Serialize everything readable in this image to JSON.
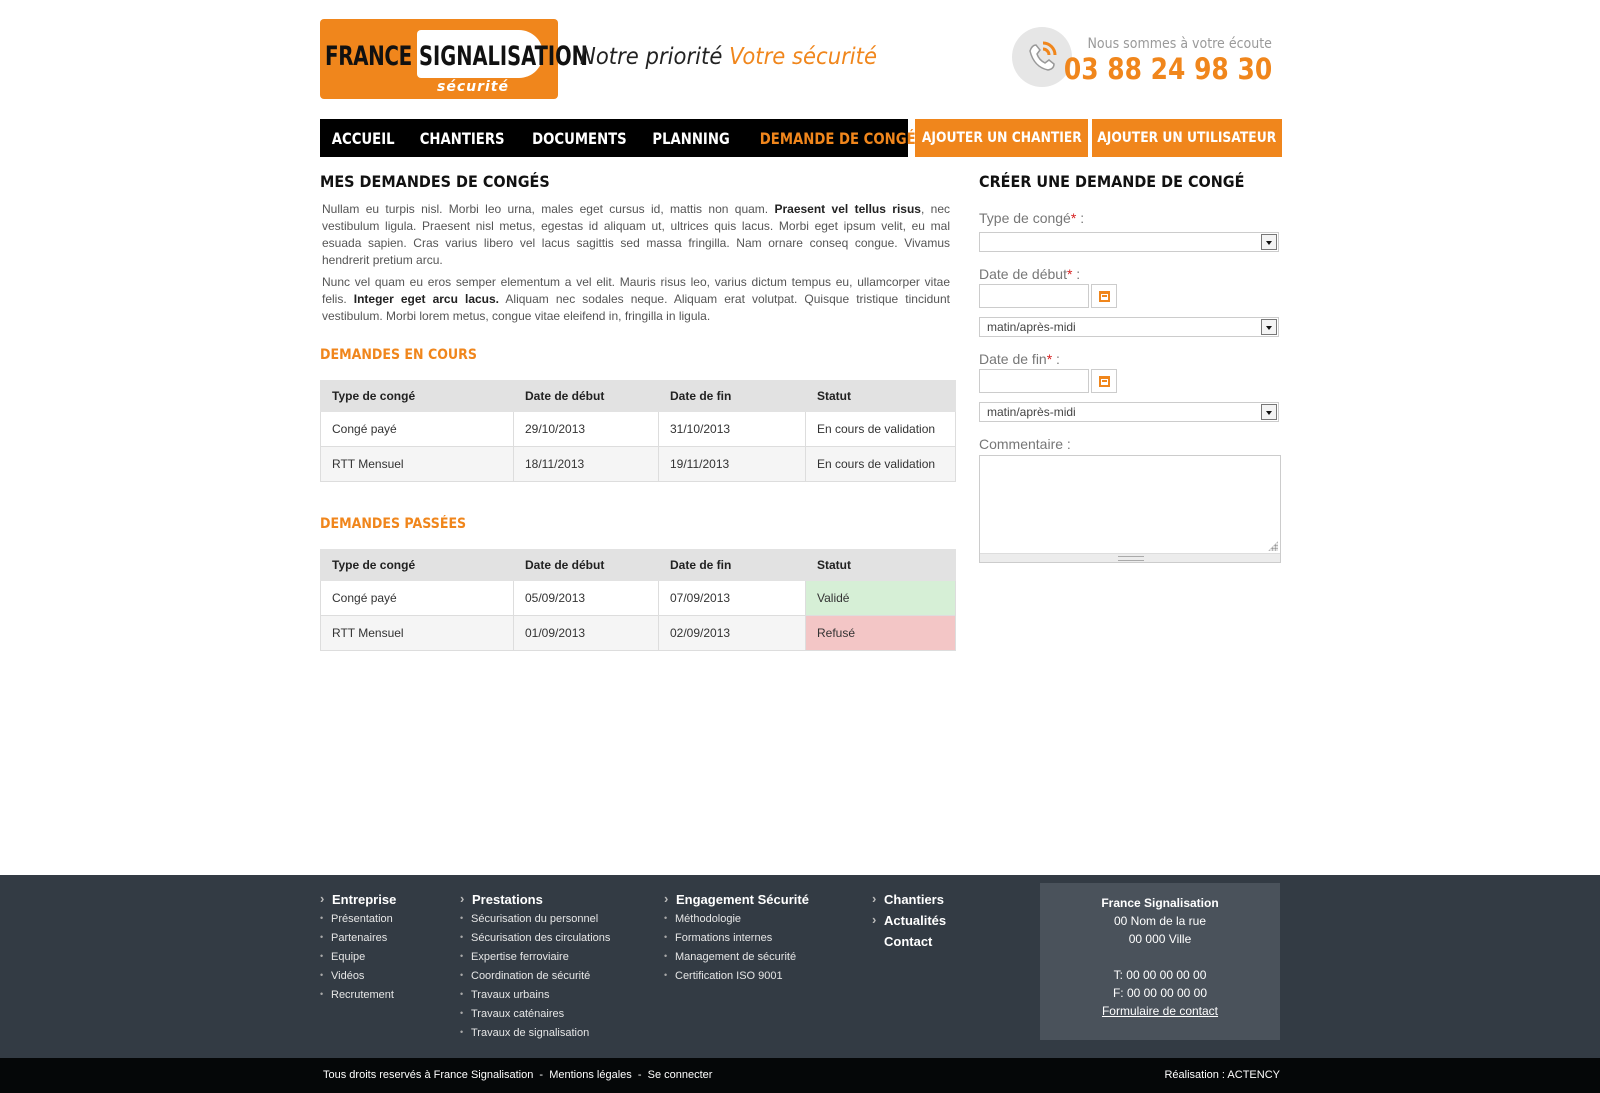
{
  "brand": {
    "logo_word1": "FRANCE",
    "logo_word2": "SIGNALISATION",
    "logo_sub": "sécurité",
    "tagline_part1": "Notre priorité",
    "tagline_part2": "Votre sécurité",
    "listen_text": "Nous sommes à votre écoute",
    "phone": "03 88 24 98 30",
    "accent_color": "#f0861c"
  },
  "nav": {
    "items": [
      {
        "label": "ACCUEIL"
      },
      {
        "label": "CHANTIERS"
      },
      {
        "label": "DOCUMENTS"
      },
      {
        "label": "PLANNING"
      },
      {
        "label": "DEMANDE DE CONGÉ",
        "active": true
      }
    ],
    "add_site": "AJOUTER UN CHANTIER",
    "add_user": "AJOUTER UN UTILISATEUR"
  },
  "main": {
    "title": "MES DEMANDES DE CONGÉS",
    "intro1_a": "Nullam eu turpis nisl. Morbi leo urna, males eget cursus id, mattis non quam. ",
    "intro1_b": "Praesent vel tellus risus",
    "intro1_c": ", nec vestibulum ligula. Praesent nisl metus, egestas id aliquam ut, ultrices quis lacus. Morbi eget ipsum velit, eu mal esuada sapien. Cras varius libero vel lacus sagittis sed massa fringilla. Nam ornare conseq congue. Vivamus hendrerit pretium arcu.",
    "intro2_a": "Nunc vel quam eu eros semper elementum a vel elit. Mauris risus leo, varius dictum tempus eu, ullamcorper vitae felis. ",
    "intro2_b": "Integer eget arcu lacus.",
    "intro2_c": " Aliquam nec sodales neque. Aliquam erat volutpat. Quisque tristique tincidunt vestibulum. Morbi lorem metus, congue vitae eleifend in, fringilla in ligula.",
    "current": {
      "title": "DEMANDES EN COURS",
      "headers": [
        "Type de congé",
        "Date de début",
        "Date de fin",
        "Statut"
      ],
      "rows": [
        [
          "Congé payé",
          "29/10/2013",
          "31/10/2013",
          "En cours de validation"
        ],
        [
          "RTT Mensuel",
          "18/11/2013",
          "19/11/2013",
          "En cours de validation"
        ]
      ]
    },
    "past": {
      "title": "DEMANDES PASSÉES",
      "headers": [
        "Type de congé",
        "Date de début",
        "Date de fin",
        "Statut"
      ],
      "rows": [
        [
          "Congé payé",
          "05/09/2013",
          "07/09/2013",
          "Validé"
        ],
        [
          "RTT Mensuel",
          "01/09/2013",
          "02/09/2013",
          "Refusé"
        ]
      ],
      "status_colors": {
        "ok": "#d6efd6",
        "ko": "#f3c6c6"
      }
    }
  },
  "form": {
    "title": "CRÉER UNE DEMANDE DE CONGÉ",
    "type_label": "Type de congé",
    "type_value": "",
    "start_label": "Date de début",
    "start_value": "",
    "start_period": "matin/après-midi",
    "end_label": "Date de fin",
    "end_value": "",
    "end_period": "matin/après-midi",
    "comment_label": "Commentaire :",
    "required_mark": "*",
    "label_suffix": " :"
  },
  "footer": {
    "cols": [
      {
        "title": "Entreprise",
        "items": [
          "Présentation",
          "Partenaires",
          "Equipe",
          "Vidéos",
          "Recrutement"
        ]
      },
      {
        "title": "Prestations",
        "items": [
          "Sécurisation du personnel",
          "Sécurisation des circulations",
          "Expertise ferroviaire",
          "Coordination de sécurité",
          "Travaux urbains",
          "Travaux caténaires",
          "Travaux de signalisation"
        ]
      },
      {
        "title": "Engagement Sécurité",
        "items": [
          "Méthodologie",
          "Formations internes",
          "Management de sécurité",
          "Certification ISO 9001"
        ]
      }
    ],
    "links": [
      "Chantiers",
      "Actualités",
      "Contact"
    ],
    "address": {
      "name": "France Signalisation",
      "street": "00 Nom de la rue",
      "city": "00 000 Ville",
      "tel": "T: 00 00 00 00 00",
      "fax": "F: 00 00 00 00 00",
      "contact": "Formulaire de contact"
    },
    "bottom_left": "Tous droits reservés à France Signalisation  -  Mentions légales  -  Se connecter",
    "bottom_right": "Réalisation : ACTENCY"
  }
}
